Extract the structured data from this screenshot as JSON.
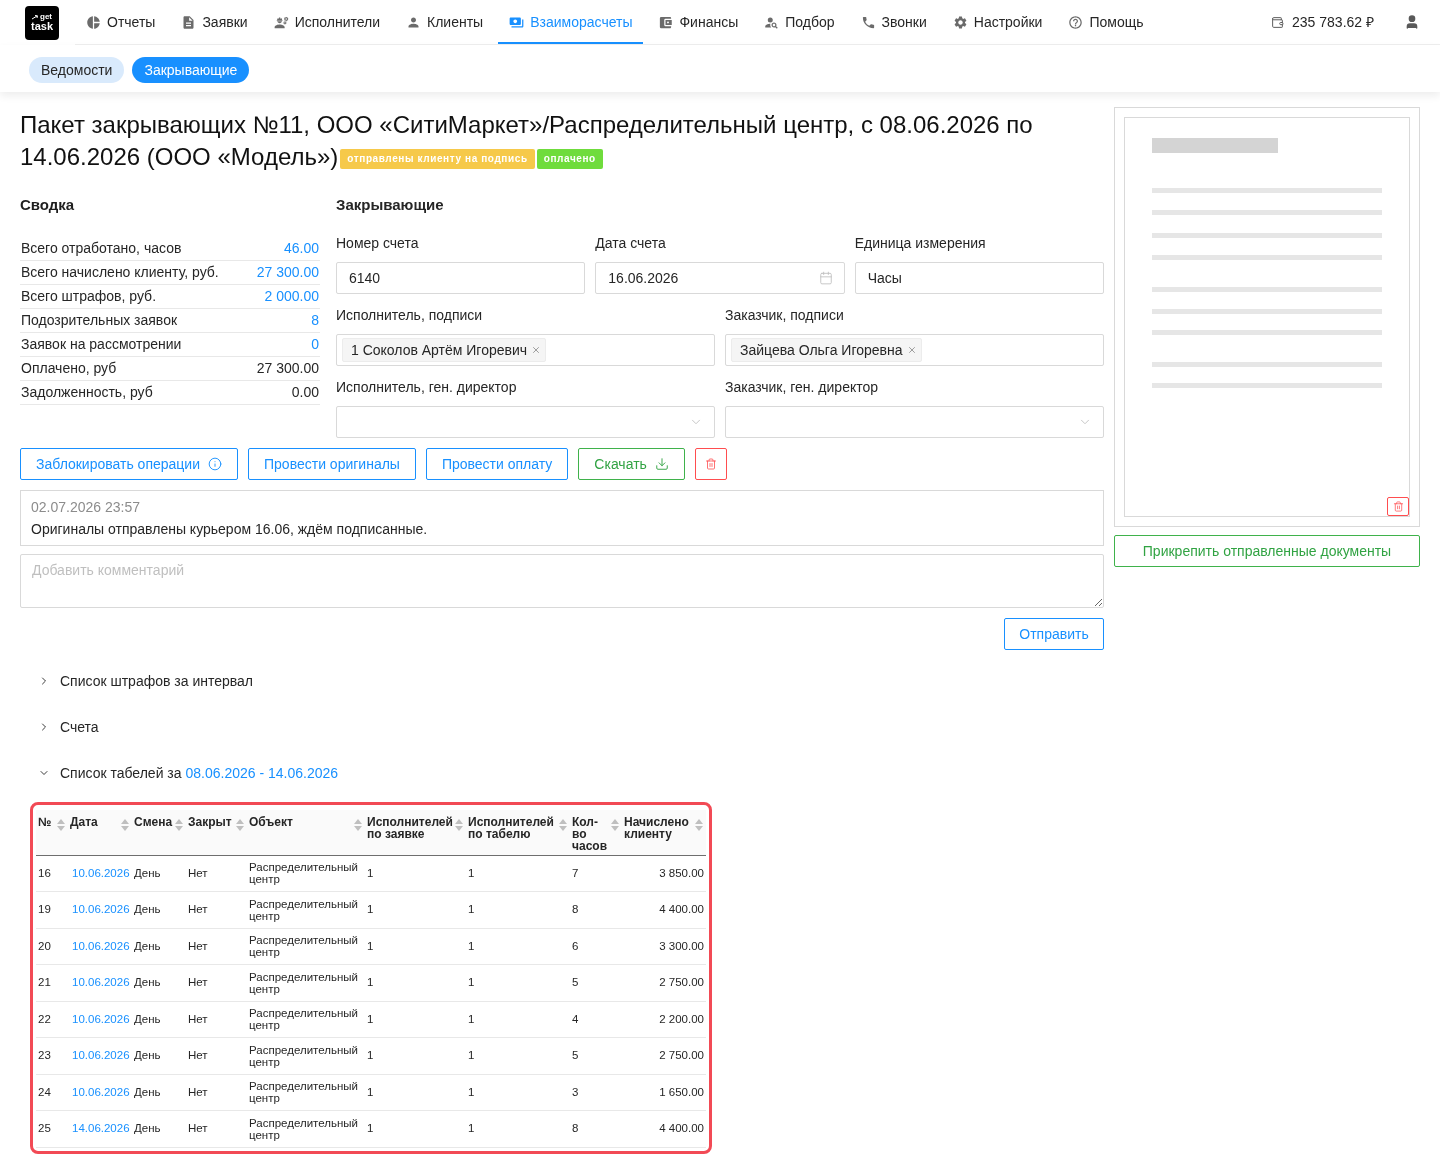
{
  "nav": {
    "logo": {
      "line_1": "get",
      "line_2": "task"
    },
    "items": [
      {
        "label": "Отчеты",
        "selected": false
      },
      {
        "label": "Заявки",
        "selected": false
      },
      {
        "label": "Исполнители",
        "selected": false
      },
      {
        "label": "Клиенты",
        "selected": false
      },
      {
        "label": "Взаиморасчеты",
        "selected": true
      },
      {
        "label": "Финансы",
        "selected": false
      },
      {
        "label": "Подбор",
        "selected": false
      },
      {
        "label": "Звонки",
        "selected": false
      },
      {
        "label": "Настройки",
        "selected": false
      },
      {
        "label": "Помощь",
        "selected": false
      }
    ],
    "balance": "235 783.62 ₽"
  },
  "subnav": [
    {
      "label": "Ведомости",
      "selected": false
    },
    {
      "label": "Закрывающие",
      "selected": true
    }
  ],
  "header": {
    "title_lines": [
      "Пакет закрывающих №11, ООО «СитиМаркет»/Распределительный центр, с 08.06.2026 по",
      "14.06.2026 (ООО «Модель»)"
    ],
    "badges": [
      {
        "label": "отправлены клиенту на подпись",
        "color": "#f6c94a"
      },
      {
        "label": "оплачено",
        "color": "#6fdc3c"
      }
    ]
  },
  "summary": {
    "title": "Сводка",
    "rows": [
      {
        "label": "Всего отработано, часов",
        "value": "46.00",
        "kind": "link"
      },
      {
        "label": "Всего начислено клиенту, руб.",
        "value": "27 300.00",
        "kind": "link"
      },
      {
        "label": "Всего штрафов, руб.",
        "value": "2 000.00",
        "kind": "link"
      },
      {
        "label": "Подозрительных заявок",
        "value": "8",
        "kind": "link"
      },
      {
        "label": "Заявок на рассмотрении",
        "value": "0",
        "kind": "link"
      },
      {
        "label": "Оплачено, руб",
        "value": "27 300.00",
        "kind": "text"
      },
      {
        "label": "Задолженность, руб",
        "value": "0.00",
        "kind": "text"
      }
    ]
  },
  "closing": {
    "title": "Закрывающие",
    "rows": [
      [
        {
          "label": "Номер счета",
          "kind": "text",
          "value": "6140"
        },
        {
          "label": "Дата счета",
          "kind": "date",
          "value": "16.06.2026"
        },
        {
          "label": "Единица измерения",
          "kind": "text",
          "value": "Часы"
        }
      ],
      [
        {
          "label": "Исполнитель, подписи",
          "kind": "tags",
          "tags": [
            "1 Соколов Артём Игоревич"
          ]
        },
        {
          "label": "Заказчик, подписи",
          "kind": "tags",
          "tags": [
            "Зайцева Ольга Игоревна"
          ]
        }
      ],
      [
        {
          "label": "Исполнитель, ген. директор",
          "kind": "select"
        },
        {
          "label": "Заказчик, ген. директор",
          "kind": "select"
        }
      ]
    ]
  },
  "actions": [
    {
      "label": "Заблокировать операции",
      "kind": "info"
    },
    {
      "label": "Провести оригиналы",
      "kind": "primary"
    },
    {
      "label": "Провести оплату",
      "kind": "primary"
    },
    {
      "label": "Скачать",
      "kind": "download"
    },
    {
      "kind": "delete"
    }
  ],
  "comments": [
    {
      "time": "02.07.2026 23:57",
      "text": "Оригиналы отправлены курьером 16.06, ждём подписанные."
    }
  ],
  "comment_field": {
    "placeholder": "Добавить комментарий"
  },
  "send_button": "Отправить",
  "sections": [
    {
      "title": "Список штрафов за интервал",
      "expanded": false
    },
    {
      "title": "Счета",
      "expanded": false
    },
    {
      "title": "Список табелей за",
      "range": "08.06.2026 - 14.06.2026",
      "expanded": true,
      "table": {
        "columns": [
          "№",
          "Дата",
          "Смена",
          "Закрыт",
          "Объект",
          "Исполнителей по заявке",
          "Исполнителей по табелю",
          "Кол-во часов",
          "Начислено клиенту"
        ],
        "rows": [
          {
            "no": "16",
            "date": "10.06.2026",
            "shift": "День",
            "closed": "Нет",
            "object": "Распределительный центр",
            "workers_by_request": "1",
            "workers_by_timesheet": "1",
            "hours": "7",
            "charged": "3 850.00"
          },
          {
            "no": "19",
            "date": "10.06.2026",
            "shift": "День",
            "closed": "Нет",
            "object": "Распределительный центр",
            "workers_by_request": "1",
            "workers_by_timesheet": "1",
            "hours": "8",
            "charged": "4 400.00"
          },
          {
            "no": "20",
            "date": "10.06.2026",
            "shift": "День",
            "closed": "Нет",
            "object": "Распределительный центр",
            "workers_by_request": "1",
            "workers_by_timesheet": "1",
            "hours": "6",
            "charged": "3 300.00"
          },
          {
            "no": "21",
            "date": "10.06.2026",
            "shift": "День",
            "closed": "Нет",
            "object": "Распределительный центр",
            "workers_by_request": "1",
            "workers_by_timesheet": "1",
            "hours": "5",
            "charged": "2 750.00"
          },
          {
            "no": "22",
            "date": "10.06.2026",
            "shift": "День",
            "closed": "Нет",
            "object": "Распределительный центр",
            "workers_by_request": "1",
            "workers_by_timesheet": "1",
            "hours": "4",
            "charged": "2 200.00"
          },
          {
            "no": "23",
            "date": "10.06.2026",
            "shift": "День",
            "closed": "Нет",
            "object": "Распределительный центр",
            "workers_by_request": "1",
            "workers_by_timesheet": "1",
            "hours": "5",
            "charged": "2 750.00"
          },
          {
            "no": "24",
            "date": "10.06.2026",
            "shift": "День",
            "closed": "Нет",
            "object": "Распределительный центр",
            "workers_by_request": "1",
            "workers_by_timesheet": "1",
            "hours": "3",
            "charged": "1 650.00"
          },
          {
            "no": "25",
            "date": "14.06.2026",
            "shift": "День",
            "closed": "Нет",
            "object": "Распределительный центр",
            "workers_by_request": "1",
            "workers_by_timesheet": "1",
            "hours": "8",
            "charged": "4 400.00"
          }
        ]
      }
    }
  ],
  "document_panel": {
    "attach_button": "Прикрепить отправленные документы"
  }
}
